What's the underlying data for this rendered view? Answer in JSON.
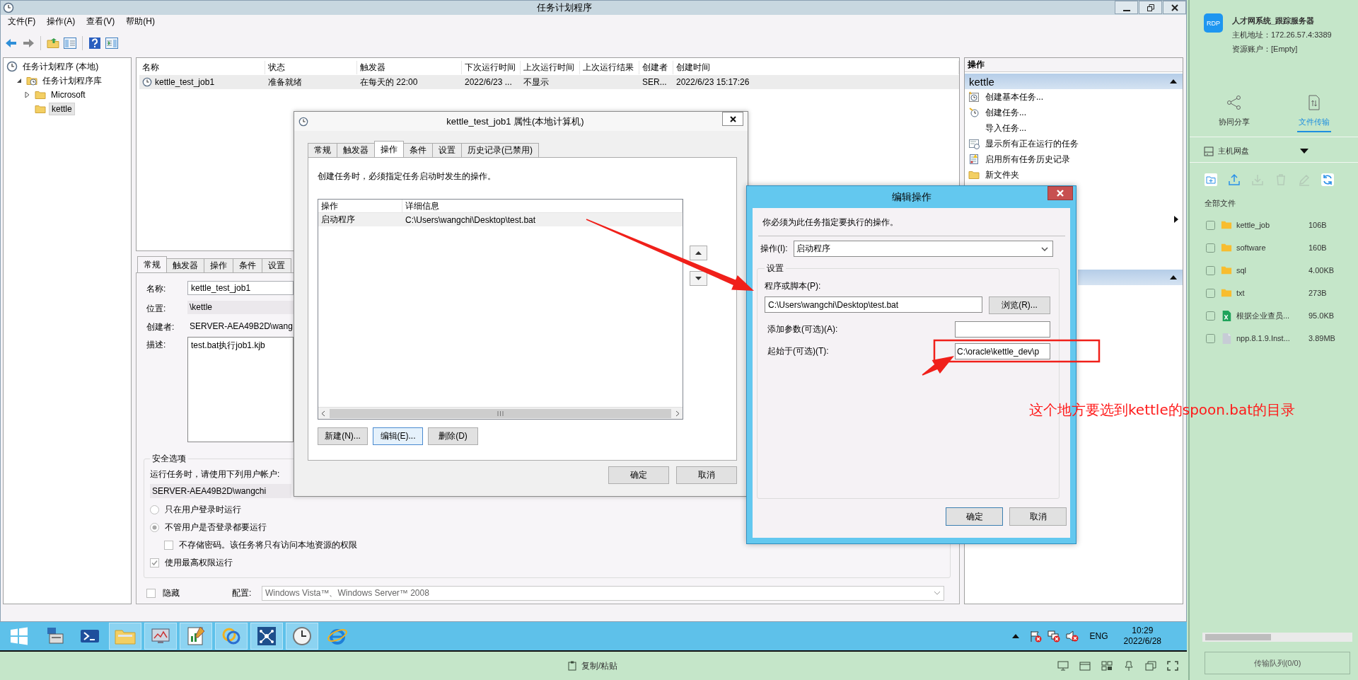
{
  "main_window": {
    "title": "任务计划程序",
    "menu": [
      "文件(F)",
      "操作(A)",
      "查看(V)",
      "帮助(H)"
    ],
    "tree": [
      {
        "label": "任务计划程序 (本地)",
        "selected": false,
        "children": [
          {
            "label": "任务计划程序库",
            "expanded": true,
            "selected": false,
            "children": [
              {
                "label": "Microsoft",
                "expanded": false,
                "selected": false
              },
              {
                "label": "kettle",
                "selected": true
              }
            ]
          }
        ]
      }
    ],
    "task_table": {
      "columns": [
        "名称",
        "状态",
        "触发器",
        "下次运行时间",
        "上次运行时间",
        "上次运行结果",
        "创建者",
        "创建时间"
      ],
      "rows": [
        {
          "cells": [
            "kettle_test_job1",
            "准备就绪",
            "在每天的 22:00",
            "2022/6/23 ...",
            "不显示",
            null,
            "SER...",
            "2022/6/23 15:17:26"
          ],
          "selected": true
        }
      ]
    },
    "detail_panel": {
      "tabs": [
        {
          "label": "常规",
          "selected": true
        },
        {
          "label": "触发器",
          "selected": false
        },
        {
          "label": "操作",
          "selected": false
        },
        {
          "label": "条件",
          "selected": false
        },
        {
          "label": "设置",
          "selected": false
        }
      ],
      "fields": [
        {
          "label": "名称:",
          "value": "kettle_test_job1",
          "kind": "input"
        },
        {
          "label": "位置:",
          "value": "\\kettle",
          "kind": "readonly"
        },
        {
          "label": "创建者:",
          "value": "SERVER-AEA49B2D\\wang",
          "kind": "text"
        },
        {
          "label": "描述:",
          "value": "test.bat执行job1.kjb",
          "kind": "textarea"
        }
      ],
      "security": {
        "title": "安全选项",
        "prompt": "运行任务时，请使用下列用户帐户:",
        "account": "SERVER-AEA49B2D\\wangchi",
        "run_modes": [
          {
            "label": "只在用户登录时运行",
            "selected": false
          },
          {
            "label": "不管用户是否登录都要运行",
            "selected": true
          }
        ],
        "store_password": {
          "label": "不存储密码。该任务将只有访问本地资源的权限",
          "checked": false
        },
        "highest_privileges": {
          "label": "使用最高权限运行",
          "checked": true
        }
      },
      "hidden": {
        "label": "隐藏",
        "checked": false
      },
      "configure": {
        "label": "配置:",
        "value": "Windows Vista™、Windows Server™ 2008"
      }
    },
    "actions_panel": {
      "title": "操作",
      "sections": [
        {
          "title": "kettle",
          "expanded": true,
          "items": [
            {
              "label": "创建基本任务...",
              "kind": "basic-task"
            },
            {
              "label": "创建任务...",
              "kind": "task"
            },
            {
              "label": "导入任务...",
              "kind": "plain"
            },
            {
              "label": "显示所有正在运行的任务",
              "kind": "running"
            },
            {
              "label": "启用所有任务历史记录",
              "kind": "history"
            },
            {
              "label": "新文件夹",
              "kind": "folder"
            }
          ]
        },
        {
          "expanded": true
        }
      ]
    }
  },
  "properties_dialog": {
    "title": "kettle_test_job1 属性(本地计算机)",
    "tabs": [
      {
        "label": "常规",
        "selected": false
      },
      {
        "label": "触发器",
        "selected": false
      },
      {
        "label": "操作",
        "selected": true
      },
      {
        "label": "条件",
        "selected": false
      },
      {
        "label": "设置",
        "selected": false
      },
      {
        "label": "历史记录(已禁用)",
        "selected": false
      }
    ],
    "intro": "创建任务时，必须指定任务启动时发生的操作。",
    "columns": [
      "操作",
      "详细信息"
    ],
    "rows": [
      {
        "cells": [
          "启动程序",
          "C:\\Users\\wangchi\\Desktop\\test.bat"
        ],
        "selected": true
      }
    ],
    "buttons": [
      "新建(N)...",
      "编辑(E)...",
      "删除(D)"
    ],
    "footer_buttons": [
      "确定",
      "取消"
    ]
  },
  "edit_dialog": {
    "title": "编辑操作",
    "intro": "你必须为此任务指定要执行的操作。",
    "action": {
      "label": "操作(I):",
      "value": "启动程序"
    },
    "group": "设置",
    "program": {
      "label": "程序或脚本(P):",
      "value": "C:\\Users\\wangchi\\Desktop\\test.bat"
    },
    "browse": "浏览(R)...",
    "arguments": {
      "label": "添加参数(可选)(A):"
    },
    "start_in": {
      "label": "起始于(可选)(T):",
      "value": "C:\\oracle\\kettle_dev\\p"
    },
    "buttons": [
      "确定",
      "取消"
    ]
  },
  "annotation": {
    "note": "这个地方要选到kettle的spoon.bat的目录"
  },
  "taskbar": {
    "apps": [
      {
        "kind": "server",
        "running": false
      },
      {
        "kind": "terminal",
        "running": false
      },
      {
        "kind": "folder",
        "running": true
      },
      {
        "kind": "monitor",
        "running": true
      },
      {
        "kind": "chart",
        "running": true
      },
      {
        "kind": "rings",
        "running": true
      },
      {
        "kind": "network",
        "running": true
      },
      {
        "kind": "clock",
        "running": true
      },
      {
        "kind": "browser",
        "running": false
      }
    ],
    "tray": {
      "language": "ENG",
      "time": "10:29",
      "date": "2022/6/28"
    }
  },
  "rdp_bar": {
    "label": "复制/粘贴"
  },
  "sidebar": {
    "logo": "RDP",
    "title": "人才网系统_跟踪服务器",
    "address": "主机地址：172.26.57.4:3389",
    "account": "资源账户：[Empty]",
    "tabs": [
      {
        "label": "协同分享",
        "kind": "share",
        "selected": false
      },
      {
        "label": "文件传输",
        "kind": "transfer",
        "selected": true
      }
    ],
    "drive": "主机网盘",
    "tools": [
      {
        "kind": "new-folder",
        "disabled": false
      },
      {
        "kind": "upload",
        "disabled": false
      },
      {
        "kind": "download",
        "disabled": true
      },
      {
        "kind": "delete",
        "disabled": true
      },
      {
        "kind": "rename",
        "disabled": true
      },
      {
        "kind": "refresh",
        "disabled": false
      }
    ],
    "heading": "全部文件",
    "files": [
      {
        "name": "kettle_job",
        "size": "106B",
        "kind": "folder",
        "checked": false
      },
      {
        "name": "software",
        "size": "160B",
        "kind": "folder",
        "checked": false
      },
      {
        "name": "sql",
        "size": "4.00KB",
        "kind": "folder",
        "checked": false
      },
      {
        "name": "txt",
        "size": "273B",
        "kind": "folder",
        "checked": false
      },
      {
        "name": "根据企业查员...",
        "size": "95.0KB",
        "kind": "sheet",
        "checked": false
      },
      {
        "name": "npp.8.1.9.Inst...",
        "size": "3.89MB",
        "kind": "file",
        "checked": false
      }
    ],
    "queue_button": "传输队列(0/0)"
  }
}
